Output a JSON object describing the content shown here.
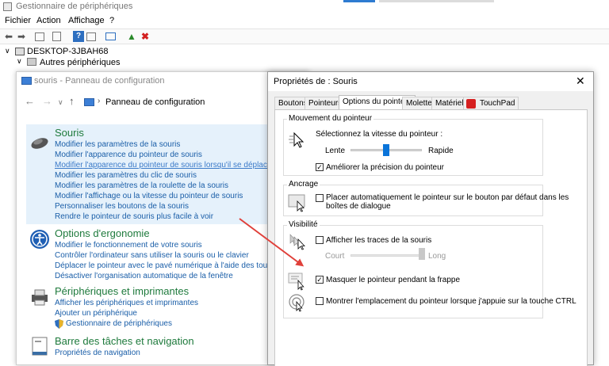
{
  "device_manager": {
    "title": "Gestionnaire de périphériques",
    "menu": [
      "Fichier",
      "Action",
      "Affichage",
      "?"
    ],
    "tree": {
      "root": "DESKTOP-3JBAH68",
      "child": "Autres périphériques"
    }
  },
  "control_panel": {
    "title": "souris - Panneau de configuration",
    "breadcrumb": "Panneau de configuration",
    "categories": [
      {
        "title": "Souris",
        "links": [
          "Modifier les paramètres de la souris",
          "Modifier l'apparence du pointeur de souris",
          "Modifier l'apparence du pointeur de souris lorsqu'il se déplace",
          "Modifier les paramètres du clic de souris",
          "Modifier les paramètres de la roulette de la souris",
          "Modifier l'affichage ou la vitesse du pointeur de souris",
          "Personnaliser les boutons de la souris",
          "Rendre le pointeur de souris plus facile à voir"
        ]
      },
      {
        "title": "Options d'ergonomie",
        "links": [
          "Modifier le fonctionnement de votre souris",
          "Contrôler l'ordinateur sans utiliser la souris ou le clavier",
          "Déplacer le pointeur avec le pavé numérique à l'aide des touches so",
          "Désactiver l'organisation automatique de la fenêtre"
        ]
      },
      {
        "title": "Périphériques et imprimantes",
        "links": [
          "Afficher les périphériques et imprimantes",
          "Ajouter un périphérique",
          "Gestionnaire de périphériques"
        ]
      },
      {
        "title": "Barre des tâches et navigation",
        "links": [
          "Propriétés de navigation"
        ]
      }
    ]
  },
  "dialog": {
    "title": "Propriétés de : Souris",
    "close": "✕",
    "tabs": [
      "Boutons",
      "Pointeurs",
      "Options du pointeur",
      "Molette",
      "Matériel",
      "TouchPad"
    ],
    "motion": {
      "legend": "Mouvement du pointeur",
      "speed_label": "Sélectionnez la vitesse du pointeur :",
      "slow": "Lente",
      "fast": "Rapide",
      "speed_level": 0.5,
      "precision_label": "Améliorer la précision du pointeur",
      "precision_checked": true
    },
    "snap": {
      "legend": "Ancrage",
      "label_line1": "Placer automatiquement le pointeur sur le bouton par défaut dans les",
      "label_line2": "boîtes de dialogue",
      "checked": false
    },
    "visibility": {
      "legend": "Visibilité",
      "trails_label": "Afficher les traces de la souris",
      "trails_checked": false,
      "short": "Court",
      "long": "Long",
      "trails_level": 1.0,
      "hide_label": "Masquer le pointeur pendant la frappe",
      "hide_checked": true,
      "ctrl_label": "Montrer l'emplacement du pointeur lorsque j'appuie sur la touche CTRL",
      "ctrl_checked": false
    }
  },
  "colors": {
    "link": "#1a5ea8",
    "category": "#1e7a3c",
    "selection": "#e5f1fb",
    "arrow": "#e0403a",
    "slider": "#0a74d9"
  }
}
